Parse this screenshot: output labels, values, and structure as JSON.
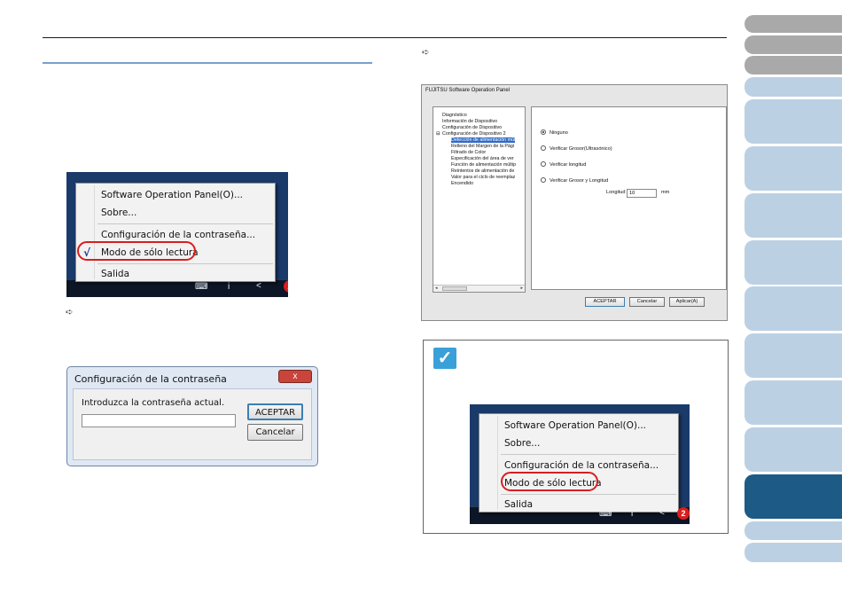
{
  "arrow_glyph": "➪",
  "context_menu": {
    "items": [
      "Software Operation Panel(O)...",
      "Sobre...",
      "Configuración de la contraseña...",
      "Modo de sólo lectura",
      "Salida"
    ],
    "checkmark": "√"
  },
  "tray": {
    "keyboard": "⌨",
    "info": "i",
    "badge": "2"
  },
  "password_dialog": {
    "title": "Configuración de la contraseña",
    "close": "x",
    "prompt": "Introduzca la contraseña actual.",
    "ok": "ACEPTAR",
    "cancel": "Cancelar"
  },
  "sop_window": {
    "title": "FUJITSU Software Operation Panel",
    "tree": [
      "Diagnóstico",
      "Información de Dispositivo",
      "Configuración de Dispositivo",
      "Configuración de Dispositivo 2",
      "Detección de alimentación múl",
      "Relleno del Margen de la Pági",
      "Filtrado de Color",
      "Especificación del área de ver",
      "Función de alimentación múltip",
      "Reintentos de alimentación de",
      "Valor para el ciclo de reemplaz",
      "Encendido"
    ],
    "options": [
      "Ninguno",
      "Verificar Grosor(Ultrasónico)",
      "Verificar longitud",
      "Verificar Grosor y Longitud"
    ],
    "length_label": "Longitud",
    "length_value": "10",
    "length_unit": "mm",
    "buttons": [
      "ACEPTAR",
      "Cancelar",
      "Aplicar(A)"
    ]
  },
  "note": {
    "icon": "hint-check-icon"
  }
}
